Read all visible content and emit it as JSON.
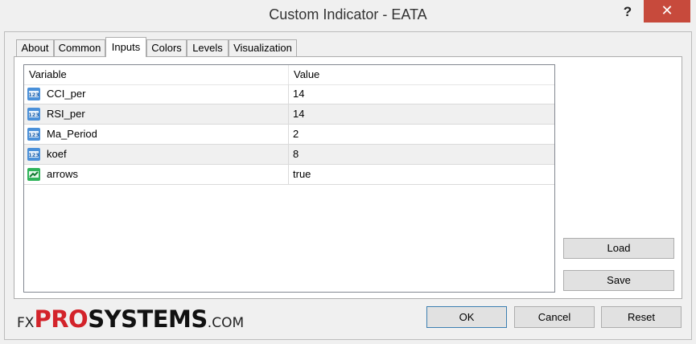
{
  "window": {
    "title": "Custom Indicator - EATA",
    "help_glyph": "?",
    "close_glyph": "✕"
  },
  "tabs": [
    {
      "label": "About",
      "active": false
    },
    {
      "label": "Common",
      "active": false
    },
    {
      "label": "Inputs",
      "active": true
    },
    {
      "label": "Colors",
      "active": false
    },
    {
      "label": "Levels",
      "active": false
    },
    {
      "label": "Visualization",
      "active": false
    }
  ],
  "table": {
    "headers": {
      "variable": "Variable",
      "value": "Value"
    },
    "rows": [
      {
        "variable": "CCI_per",
        "value": "14",
        "icon": "integer-icon"
      },
      {
        "variable": "RSI_per",
        "value": "14",
        "icon": "integer-icon"
      },
      {
        "variable": "Ma_Period",
        "value": "2",
        "icon": "integer-icon"
      },
      {
        "variable": "koef",
        "value": "8",
        "icon": "integer-icon"
      },
      {
        "variable": "arrows",
        "value": "true",
        "icon": "boolean-icon"
      }
    ]
  },
  "side_buttons": {
    "load": "Load",
    "save": "Save"
  },
  "footer_buttons": {
    "ok": "OK",
    "cancel": "Cancel",
    "reset": "Reset"
  },
  "logo": {
    "fx": "FX",
    "pro": "PRO",
    "systems": "SYSTEMS",
    "com": ".COM"
  },
  "colors": {
    "close_button": "#c74a3c",
    "logo_red": "#d3232a",
    "integer_icon": "#4a90d9",
    "boolean_icon": "#2fb35a"
  }
}
